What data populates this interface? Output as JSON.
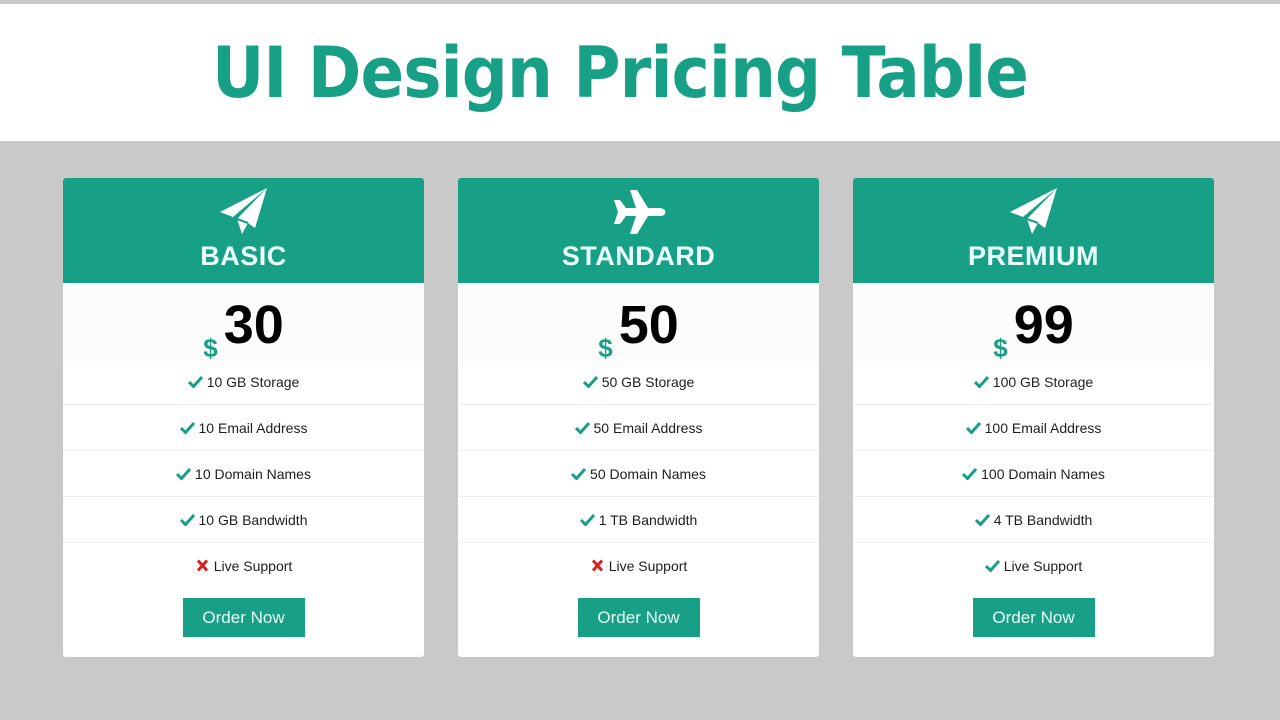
{
  "page_title": "UI Design Pricing Table",
  "colors": {
    "accent": "#17a086",
    "background": "#c9c9c9",
    "check": "#17a086",
    "cross": "#d9231e"
  },
  "plans": [
    {
      "name": "BASIC",
      "icon": "paper-plane-icon",
      "currency": "$",
      "price": "30",
      "features": [
        {
          "text": "10 GB Storage",
          "included": true
        },
        {
          "text": "10 Email Address",
          "included": true
        },
        {
          "text": "10 Domain Names",
          "included": true
        },
        {
          "text": "10 GB Bandwidth",
          "included": true
        },
        {
          "text": "Live Support",
          "included": false
        }
      ],
      "button_label": "Order Now"
    },
    {
      "name": "STANDARD",
      "icon": "airplane-icon",
      "currency": "$",
      "price": "50",
      "features": [
        {
          "text": "50 GB Storage",
          "included": true
        },
        {
          "text": "50 Email Address",
          "included": true
        },
        {
          "text": "50 Domain Names",
          "included": true
        },
        {
          "text": "1 TB Bandwidth",
          "included": true
        },
        {
          "text": "Live Support",
          "included": false
        }
      ],
      "button_label": "Order Now"
    },
    {
      "name": "PREMIUM",
      "icon": "paper-plane-icon",
      "currency": "$",
      "price": "99",
      "features": [
        {
          "text": "100 GB Storage",
          "included": true
        },
        {
          "text": "100 Email Address",
          "included": true
        },
        {
          "text": "100 Domain Names",
          "included": true
        },
        {
          "text": "4 TB Bandwidth",
          "included": true
        },
        {
          "text": "Live Support",
          "included": true
        }
      ],
      "button_label": "Order Now"
    }
  ]
}
